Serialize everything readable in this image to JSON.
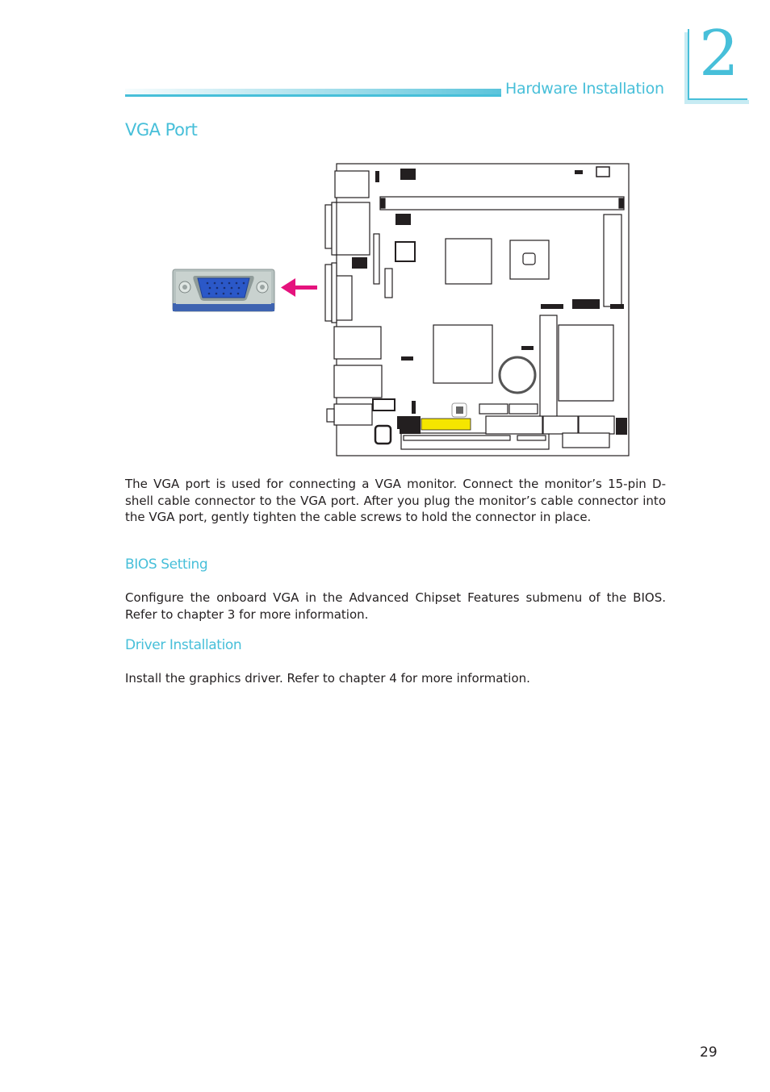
{
  "header": {
    "section_title": "Hardware Installation",
    "chapter_number": "2"
  },
  "main": {
    "title": "VGA Port",
    "intro": "The VGA port is used for connecting a VGA monitor. Connect the monitor’s 15-pin D-shell cable connector to the VGA port. After you plug the monitor’s cable connector into the VGA port, gently tighten the cable screws to hold the connector in place.",
    "sections": [
      {
        "heading": "BIOS Setting",
        "body": "Configure the onboard VGA in the Advanced Chipset Features submenu of the BIOS. Refer to chapter 3 for more information."
      },
      {
        "heading": "Driver Installation",
        "body": "Install the graphics driver. Refer to chapter 4 for more information."
      }
    ]
  },
  "figure": {
    "subject": "motherboard-layout-vga-port-location",
    "photo": "vga-port-connector-photo",
    "arrow_color": "#e5127d",
    "connector_color": "#2b58c8",
    "highlight_color": "#f5e600",
    "accent_color": "#47bfd9"
  },
  "footer": {
    "page_number": "29"
  }
}
